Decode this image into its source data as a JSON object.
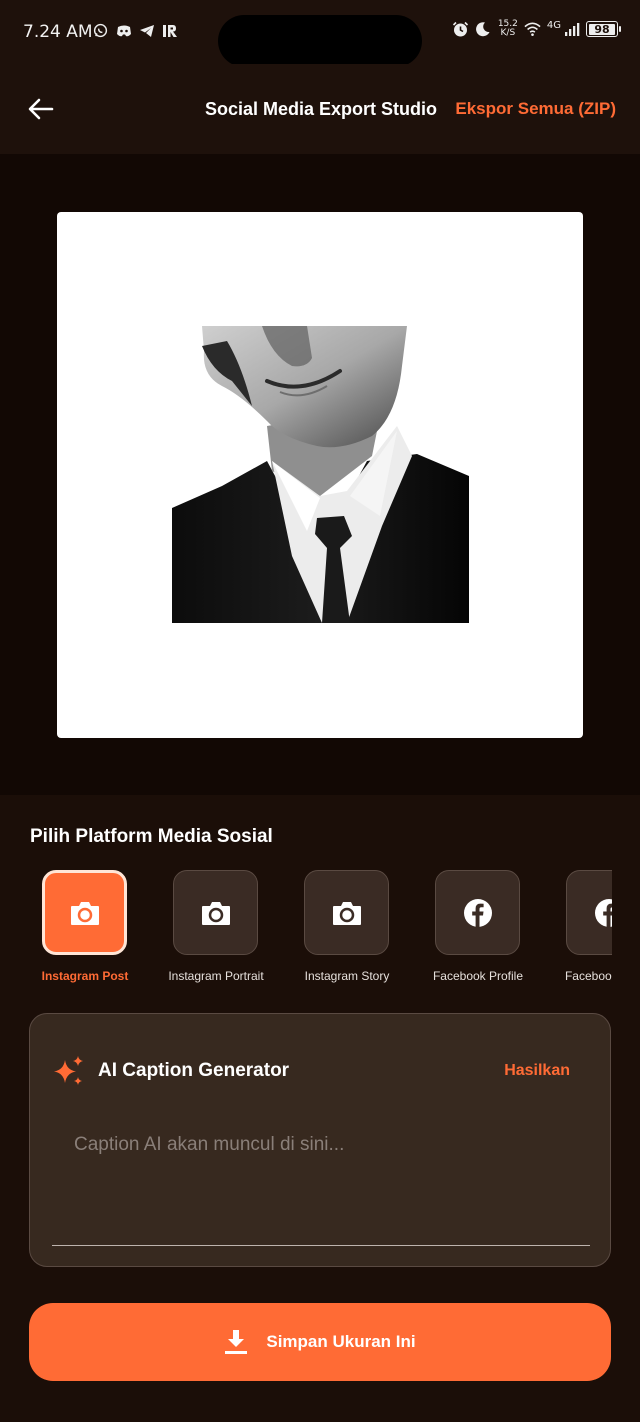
{
  "status_bar": {
    "time": "7.24 AM",
    "left_icons": [
      "whatsapp-icon",
      "discord-icon",
      "telegram-icon",
      "ir-icon"
    ],
    "right_icons": [
      "alarm-icon",
      "moon-icon",
      "wifi-icon",
      "signal-icon"
    ],
    "net_speed_value": "15.2",
    "net_speed_unit": "K/S",
    "net_type": "4G",
    "battery": "98"
  },
  "app_bar": {
    "title": "Social Media Export Studio",
    "export_all": "Ekspor Semua (ZIP)"
  },
  "platforms": {
    "title": "Pilih Platform Media Sosial",
    "items": [
      {
        "label": "Instagram Post",
        "icon": "camera-icon",
        "selected": true
      },
      {
        "label": "Instagram Portrait",
        "icon": "camera-icon",
        "selected": false
      },
      {
        "label": "Instagram Story",
        "icon": "camera-icon",
        "selected": false
      },
      {
        "label": "Facebook Profile",
        "icon": "facebook-icon",
        "selected": false
      },
      {
        "label": "Facebook Cover",
        "icon": "facebook-icon",
        "selected": false
      }
    ]
  },
  "caption": {
    "title": "AI Caption Generator",
    "generate": "Hasilkan",
    "placeholder": "Caption AI akan muncul di sini..."
  },
  "save": {
    "label": "Simpan Ukuran Ini"
  },
  "colors": {
    "accent": "#ff6b35",
    "background": "#1b0e08",
    "card": "#37291f"
  }
}
